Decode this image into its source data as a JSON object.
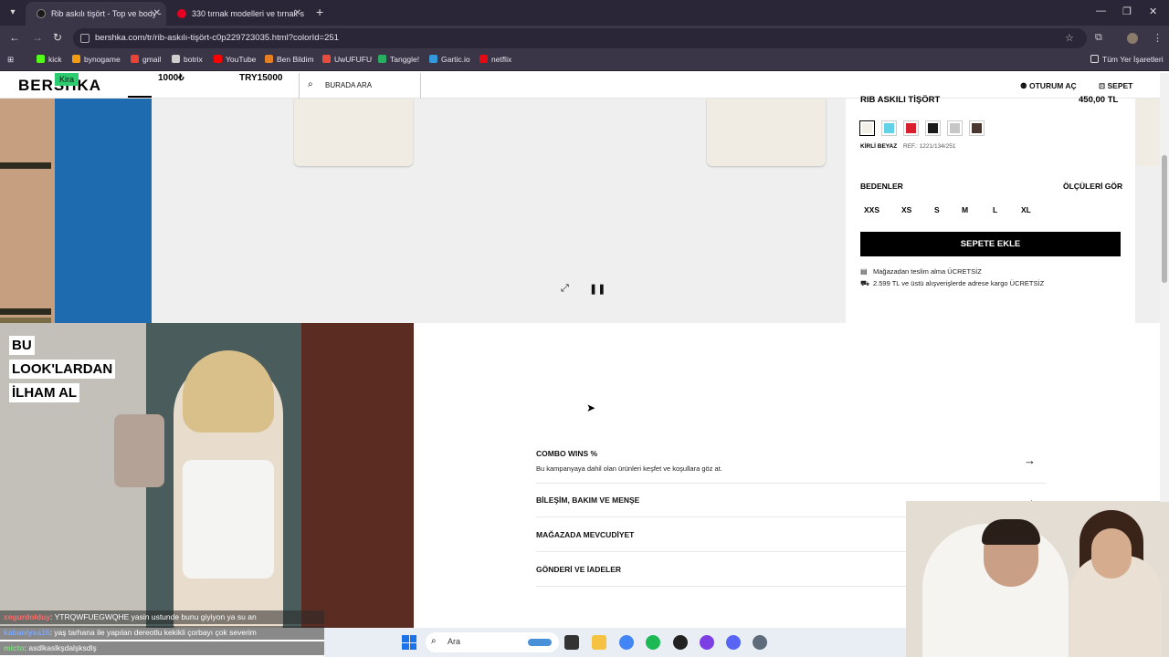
{
  "browser": {
    "tabs": [
      {
        "title": "Rib askılı tişört - Top ve body -",
        "active": true,
        "favicon_color": "#1a1a1a"
      },
      {
        "title": "330 tırnak modelleri ve tırnak s",
        "active": false,
        "favicon_color": "#e60023"
      }
    ],
    "new_tab": "+",
    "url": "bershka.com/tr/rib-askılı-tişört-c0p229723035.html?colorId=251",
    "bookmarks": [
      {
        "label": "kick",
        "color": "#53fc18"
      },
      {
        "label": "bynogame",
        "color": "#f39c12"
      },
      {
        "label": "gmail",
        "color": "#ea4335"
      },
      {
        "label": "botrix",
        "color": "#cfcfcf"
      },
      {
        "label": "YouTube",
        "color": "#ff0000"
      },
      {
        "label": "Ben Bildim",
        "color": "#e67e22"
      },
      {
        "label": "UwUFUFU",
        "color": "#e74c3c"
      },
      {
        "label": "Tanggle!",
        "color": "#27ae60"
      },
      {
        "label": "Gartic.io",
        "color": "#3498db"
      },
      {
        "label": "netflix",
        "color": "#e50914"
      }
    ],
    "all_bookmarks": "Tüm Yer İşaretleri"
  },
  "overlay": {
    "kira": "Kira",
    "amount1": "1000₺",
    "amount2": "TRY15000"
  },
  "header": {
    "logo": "BERSHKA",
    "search_placeholder": "BURADA ARA",
    "login": "OTURUM AÇ",
    "cart": "SEPET"
  },
  "product": {
    "title": "RIB ASKILI TİŞÖRT",
    "price": "450,00 TL",
    "colors": [
      "#f2efe6",
      "#62d3e6",
      "#d8202f",
      "#1b1b1b",
      "#c7c7c7",
      "#4a3730"
    ],
    "selected_color_index": 0,
    "color_name": "KİRLİ BEYAZ",
    "ref": "REF.: 1221/134/251",
    "sizes_label": "BEDENLER",
    "size_guide": "ÖLÇÜLERİ GÖR",
    "sizes": [
      "XXS",
      "XS",
      "S",
      "M",
      "L",
      "XL"
    ],
    "add_to_cart": "SEPETE EKLE",
    "shipping": [
      "Mağazadan teslim alma ÜCRETSİZ",
      "2.599 TL ve üstü alışverişlerde adrese kargo ÜCRETSİZ"
    ]
  },
  "look": {
    "lines": [
      "BU",
      "LOOK'LARDAN",
      "İLHAM AL"
    ]
  },
  "accordion": [
    {
      "title": "COMBO WINS %",
      "subtitle": "Bu kampanyaya dahil olan ürünleri keşfet ve koşullara göz at."
    },
    {
      "title": "BİLEŞİM, BAKIM VE MENŞE",
      "subtitle": ""
    },
    {
      "title": "MAĞAZADA MEVCUDİYET",
      "subtitle": ""
    },
    {
      "title": "GÖNDERİ VE İADELER",
      "subtitle": ""
    }
  ],
  "chat": [
    {
      "user": "xegurdolduy",
      "text": ": YTRQWFUEGWQHE yasin ustunde bunu giyiyon ya su an"
    },
    {
      "user": "kabanlysa16",
      "text": ": yaş tarhana ile yapılan dereotlu kekikli çorbayı çok severim"
    },
    {
      "user": "micto",
      "text": ": asdlkaslkşdalşksdlş"
    }
  ],
  "taskbar": {
    "search": "Ara"
  }
}
